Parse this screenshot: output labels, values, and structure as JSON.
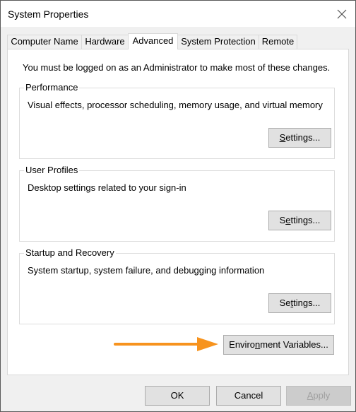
{
  "window": {
    "title": "System Properties",
    "close_icon": "close-icon"
  },
  "tabs": [
    {
      "label": "Computer Name",
      "active": false
    },
    {
      "label": "Hardware",
      "active": false
    },
    {
      "label": "Advanced",
      "active": true
    },
    {
      "label": "System Protection",
      "active": false
    },
    {
      "label": "Remote",
      "active": false
    }
  ],
  "advanced": {
    "notice": "You must be logged on as an Administrator to make most of these changes.",
    "groups": [
      {
        "label": "Performance",
        "description": "Visual effects, processor scheduling, memory usage, and virtual memory",
        "button": {
          "pre": "",
          "accel": "S",
          "post": "ettings..."
        }
      },
      {
        "label": "User Profiles",
        "description": "Desktop settings related to your sign-in",
        "button": {
          "pre": "S",
          "accel": "e",
          "post": "ttings..."
        }
      },
      {
        "label": "Startup and Recovery",
        "description": "System startup, system failure, and debugging information",
        "button": {
          "pre": "Se",
          "accel": "t",
          "post": "tings..."
        }
      }
    ],
    "env_button": {
      "pre": "Enviro",
      "accel": "n",
      "post": "ment Variables..."
    },
    "annotation": {
      "type": "arrow",
      "color": "#f7931e",
      "points_to": "env-variables-button"
    }
  },
  "footer": {
    "ok": "OK",
    "cancel": "Cancel",
    "apply": {
      "pre": "",
      "accel": "A",
      "post": "pply",
      "enabled": false
    }
  }
}
